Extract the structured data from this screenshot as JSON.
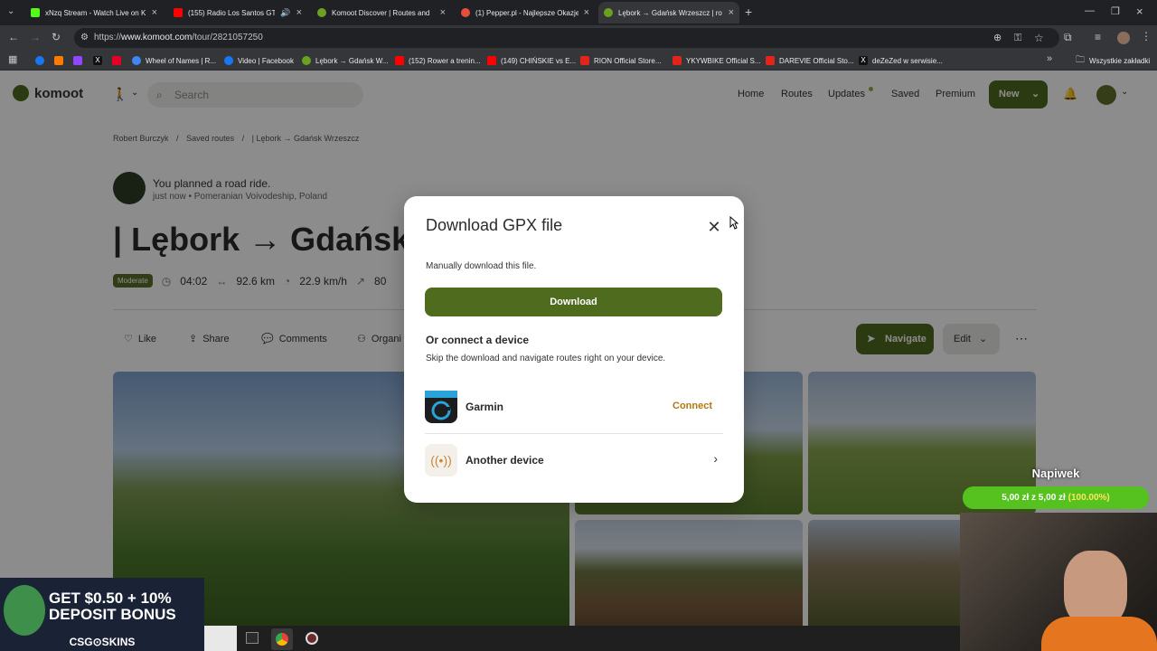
{
  "tabs": [
    {
      "title": "xNzq Stream - Watch Live on K",
      "color": "#53fc18"
    },
    {
      "title": "(155) Radio Los Santos GTA",
      "color": "#ff0000"
    },
    {
      "title": "Komoot Discover | Routes and",
      "color": "#6aa121"
    },
    {
      "title": "(1) Pepper.pl - Najlepsze Okazje",
      "color": "#e84d3c"
    },
    {
      "title": "Lębork → Gdańsk Wrzeszcz | ro",
      "color": "#6aa121"
    }
  ],
  "address": {
    "prefix": "https://",
    "domain": "www.komoot.com",
    "path": "/tour/2821057250"
  },
  "bookmarks": [
    {
      "label": "",
      "color": "#1877f2"
    },
    {
      "label": "",
      "color": "#ff7a00"
    },
    {
      "label": "",
      "color": "#9146ff"
    },
    {
      "label": "",
      "color": "#111111"
    },
    {
      "label": "",
      "color": "#e60023"
    },
    {
      "label": "Wheel of Names | R...",
      "color": "#4285f4"
    },
    {
      "label": "Video | Facebook",
      "color": "#1877f2"
    },
    {
      "label": "Lębork → Gdańsk W...",
      "color": "#6aa121"
    },
    {
      "label": "(152) Rower a trenin...",
      "color": "#ff0000"
    },
    {
      "label": "(149) CHIŃSKIE vs E...",
      "color": "#ff0000"
    },
    {
      "label": "RION Official Store...",
      "color": "#e1251b"
    },
    {
      "label": "YKYWBIKE Official S...",
      "color": "#e1251b"
    },
    {
      "label": "DAREVIE Official Sto...",
      "color": "#e1251b"
    },
    {
      "label": "deZeZed w serwisie...",
      "color": "#111111"
    }
  ],
  "bookmarks_all": "Wszystkie zakładki",
  "site": {
    "brand": "komoot",
    "search_placeholder": "Search",
    "nav": [
      "Home",
      "Routes",
      "Updates",
      "Saved",
      "Premium"
    ],
    "new_label": "New",
    "breadcrumb": [
      "Robert Burczyk",
      "Saved routes",
      "| Lębork → Gdańsk Wrzeszcz"
    ],
    "activity": "You planned a road ride.",
    "when_where": "just now • Pomeranian Voivodeship, Poland",
    "title": "| Lębork → Gdańsk",
    "difficulty": "Moderate",
    "duration": "04:02",
    "distance": "92.6 km",
    "speed": "22.9 km/h",
    "elevation": "80",
    "actions": [
      "Like",
      "Share",
      "Comments",
      "Organi"
    ],
    "navigate_label": "Navigate",
    "edit_label": "Edit"
  },
  "modal": {
    "title": "Download GPX file",
    "subtitle": "Manually download this file.",
    "download_label": "Download",
    "connect_heading": "Or connect a device",
    "connect_desc": "Skip the download and navigate routes right on your device.",
    "devices": [
      {
        "name": "Garmin",
        "action": "Connect"
      },
      {
        "name": "Another device",
        "action": ""
      }
    ]
  },
  "tip": {
    "title": "Napiwek",
    "progress_text": "5,00 zł z 5,00 zł",
    "percent_text": "(100.00%)",
    "progress": 1.0
  },
  "promo": {
    "line1": "GET $0.50 + 10%",
    "line2": "DEPOSIT BONUS",
    "brand": "CSG⊙SKINS"
  }
}
